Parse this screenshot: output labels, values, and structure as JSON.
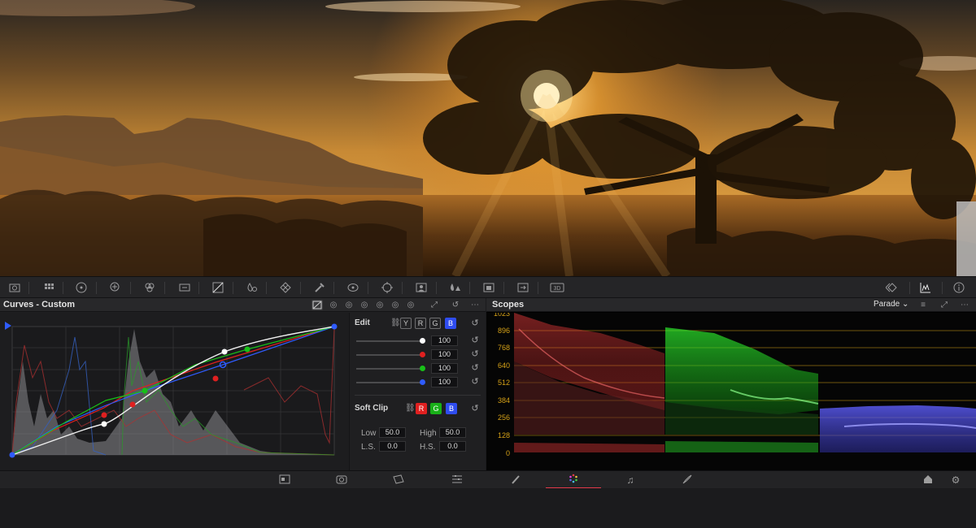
{
  "curves": {
    "title": "Curves - Custom",
    "edit_label": "Edit",
    "channel_buttons": [
      "Y",
      "R",
      "G",
      "B"
    ],
    "intensity": [
      {
        "channel": "Y",
        "value": "100",
        "color": "#ffffff"
      },
      {
        "channel": "R",
        "value": "100",
        "color": "#e02020"
      },
      {
        "channel": "G",
        "value": "100",
        "color": "#18c018"
      },
      {
        "channel": "B",
        "value": "100",
        "color": "#2f5cff"
      }
    ],
    "soft_clip_label": "Soft Clip",
    "soft_clip_buttons": [
      "R",
      "G",
      "B"
    ],
    "low_label": "Low",
    "low_value": "50.0",
    "high_label": "High",
    "high_value": "50.0",
    "ls_label": "L.S.",
    "ls_value": "0.0",
    "hs_label": "H.S.",
    "hs_value": "0.0"
  },
  "scopes": {
    "title": "Scopes",
    "mode": "Parade",
    "scale": [
      "1023",
      "896",
      "768",
      "640",
      "512",
      "384",
      "256",
      "128",
      "0"
    ]
  },
  "icons": {
    "toolbar": [
      "camera-raw-icon",
      "color-match-icon",
      "primaries-wheels-icon",
      "hdr-wheels-icon",
      "rgb-mixer-icon",
      "motion-effects-icon",
      "curves-icon",
      "color-warper-icon",
      "qualifier-icon",
      "window-icon",
      "tracker-icon",
      "magic-mask-icon",
      "blur-icon",
      "key-icon",
      "sizing-icon",
      "3d-icon",
      "keyframes-icon",
      "scopes-icon",
      "info-icon"
    ],
    "pages": [
      "media-page-icon",
      "cut-page-icon",
      "edit-page-icon",
      "fusion-page-icon",
      "color-page-icon",
      "fairlight-page-icon",
      "deliver-page-icon",
      "home-icon",
      "settings-icon"
    ]
  },
  "colors": {
    "accent_active_page": "#e2394a",
    "panel_bg": "#1f1f21"
  }
}
